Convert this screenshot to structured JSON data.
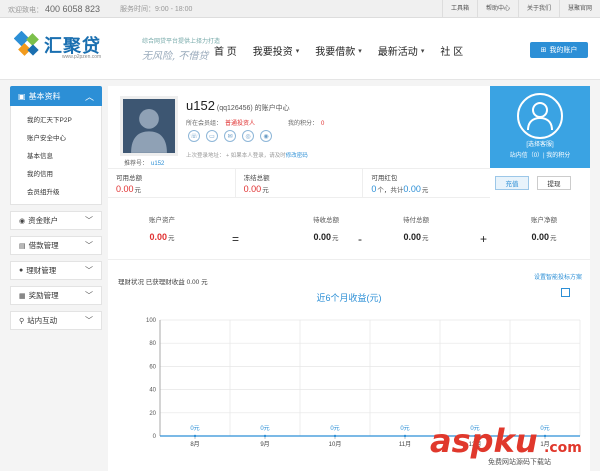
{
  "topbar": {
    "hotline_label": "欢迎致电：",
    "hotline_number": "400 6058 823",
    "hours": "服务时间：9:00 - 18:00",
    "links": [
      "工具箱",
      "帮助中心",
      "关于我们",
      "慧聚官网"
    ]
  },
  "header": {
    "logo_text": "汇聚贷",
    "logo_url": "www.p2pzen.com",
    "slogan_line1": "综合网贷平台提供上择力打造",
    "slogan_line2": "无风险, 不借贷",
    "nav": [
      "首 页",
      "我要投资",
      "我要借款",
      "最新活动",
      "社 区"
    ],
    "account_button": "我的账户"
  },
  "sidebar": {
    "section_title": "基本资料",
    "items": [
      "我的汇天下P2P",
      "账户安全中心",
      "基本信息",
      "我的信用",
      "会员组升级"
    ],
    "sections": [
      {
        "label": "资金账户",
        "icon": "wallet-icon"
      },
      {
        "label": "借款管理",
        "icon": "doc-icon"
      },
      {
        "label": "理财管理",
        "icon": "piggy-icon"
      },
      {
        "label": "奖励管理",
        "icon": "gift-icon"
      },
      {
        "label": "站内互动",
        "icon": "chat-icon"
      }
    ]
  },
  "profile": {
    "username": "u152",
    "username_suffix": "(qq126456) 的账户中心",
    "grade_label": "所在会员组：",
    "grade_value": "普通投资人",
    "credit_label": "我的积分：",
    "credit_value": "0",
    "referrer_label": "推荐号：",
    "referrer_value": "u152",
    "last_login_text": "上次登录地址：  + 如果本人登录，请及时",
    "change_password_link": "修改密码"
  },
  "service": {
    "title": "[选择客服]",
    "inbox": "站内信（0）| 我的积分"
  },
  "balances": [
    {
      "label": "可用总额",
      "value": "0.00",
      "unit": "元"
    },
    {
      "label": "冻结总额",
      "value": "0.00",
      "unit": "元"
    },
    {
      "label": "可用红包",
      "value": "0",
      "unit": "个，共计",
      "value2": "0.00",
      "unit2": "元"
    }
  ],
  "buttons": {
    "recharge": "充值",
    "withdraw": "提现"
  },
  "assets": [
    {
      "label": "账户资产",
      "value": "0.00",
      "unit": "元"
    },
    {
      "label": "待收总额",
      "value": "0.00",
      "unit": "元"
    },
    {
      "label": "待付总额",
      "value": "0.00",
      "unit": "元"
    },
    {
      "label": "账户净额",
      "value": "0.00",
      "unit": "元"
    }
  ],
  "operators": [
    "=",
    "-",
    "+"
  ],
  "income": {
    "text": "理财状况 已获理财收益 0.00 元",
    "smart_bid_link": "设置智能投标方案"
  },
  "chart_data": {
    "type": "line",
    "title": "近6个月收益(元)",
    "categories": [
      "8月",
      "9月",
      "10月",
      "11月",
      "12月",
      "1月"
    ],
    "series": [
      {
        "values": [
          0,
          0,
          0,
          0,
          0,
          0
        ]
      }
    ],
    "point_labels": [
      "0元",
      "0元",
      "0元",
      "0元",
      "0元",
      "0元"
    ],
    "ylim": [
      0,
      100
    ],
    "yticks": [
      0,
      20,
      40,
      60,
      80,
      100
    ],
    "grid": true
  },
  "watermark": {
    "main": "aspku",
    "suffix": ".com",
    "sub": "免费网站源码下载站"
  },
  "colors": {
    "accent": "#2c8fd6",
    "alert": "#e03030",
    "service_bg": "#3aa3e3"
  }
}
